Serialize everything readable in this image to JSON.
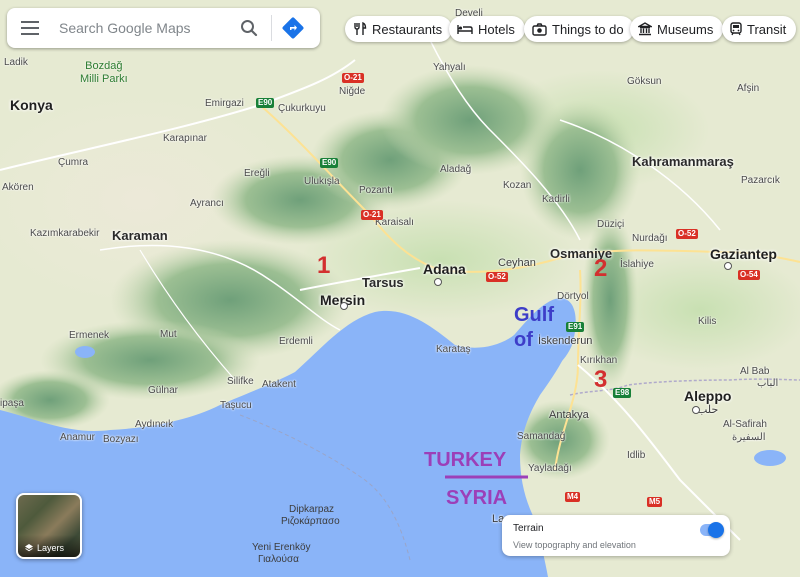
{
  "search": {
    "placeholder": "Search Google Maps"
  },
  "chips": [
    {
      "label": "Restaurants",
      "icon": "fork-knife-icon"
    },
    {
      "label": "Hotels",
      "icon": "bed-icon"
    },
    {
      "label": "Things to do",
      "icon": "camera-icon"
    },
    {
      "label": "Museums",
      "icon": "museum-icon"
    },
    {
      "label": "Transit",
      "icon": "train-icon"
    }
  ],
  "layers": {
    "label": "Layers"
  },
  "terrain": {
    "title": "Terrain",
    "subtitle": "View topography and elevation",
    "enabled": true
  },
  "places": {
    "konya": "Konya",
    "karaman": "Karaman",
    "mersin": "Mersin",
    "tarsus": "Tarsus",
    "adana": "Adana",
    "ceyhan": "Ceyhan",
    "osmaniye": "Osmaniye",
    "gaziantep": "Gaziantep",
    "kahramanmaras": "Kahramanmaraş",
    "aleppo": "Aleppo",
    "aleppo_ar": "حلب",
    "iskenderun": "İskenderun",
    "antakya": "Antakya",
    "samandag": "Samandağ",
    "yayladagi": "Yayladağı",
    "idlib": "Idlib",
    "kilis": "Kilis",
    "al_bab": "Al Bab",
    "al_bab_ar": "الباب",
    "al_safirah": "Al-Safirah",
    "al_safirah_ar": "السفيرة",
    "erdemli": "Erdemli",
    "silifke": "Silifke",
    "atakent": "Atakent",
    "tasucu": "Taşucu",
    "gulnar": "Gülnar",
    "mut": "Mut",
    "ermenek": "Ermenek",
    "anamur": "Anamur",
    "bozyazi": "Bozyazı",
    "aydincik": "Aydıncık",
    "karatas": "Karataş",
    "dortyol": "Dörtyol",
    "kirikhan": "Kırıkhan",
    "islahiye": "İslahiye",
    "nurdagi": "Nurdağı",
    "duzici": "Düziçi",
    "kadirli": "Kadirli",
    "kozan": "Kozan",
    "aladag": "Aladağ",
    "pozanti": "Pozantı",
    "karaisali": "Karaisalı",
    "ulukisla": "Ulukışla",
    "eregli": "Ereğli",
    "aycinci": "Ayrancı",
    "cumra": "Çumra",
    "karapinar": "Karapınar",
    "emirgazi": "Emirgazi",
    "cukurkuyu": "Çukurkuyu",
    "nigde": "Niğde",
    "yahyali": "Yahyalı",
    "develi": "Develi",
    "goksun": "Göksun",
    "afsin": "Afşin",
    "pazarcik": "Pazarcık",
    "ladik": "Ladik",
    "akoren": "Akören",
    "kazimkarabekir": "Kazımkarabekir",
    "bozdag_park": "Bozdağ\nMilli Parkı",
    "dipkarpaz": "Dipkarpaz",
    "rizokarpaso": "Ριζοκάρπασο",
    "yeni_erenkoy": "Yeni Erenköy",
    "yialousa": "Γιαλούσα",
    "pasa": "ipaşa",
    "la": "La",
    "kilis2": "Kilis"
  },
  "roads": [
    "E90",
    "O-21",
    "O-52",
    "E91",
    "E98",
    "M4",
    "M5",
    "O-54",
    "E90",
    "O-21",
    "O-52"
  ],
  "annotations": {
    "n1": "1",
    "n2": "2",
    "n3": "3",
    "gulf": "Gulf",
    "of": "of",
    "turkey": "TURKEY",
    "syria": "SYRIA"
  },
  "colors": {
    "sea": "#8ab4f8",
    "land": "#e9ecd6",
    "mountain": "#a9c49a",
    "annotation_red": "#d32f2f",
    "annotation_blue": "#3d3dc8",
    "annotation_purple": "#9c3fb8",
    "toggle": "#1a73e8"
  }
}
